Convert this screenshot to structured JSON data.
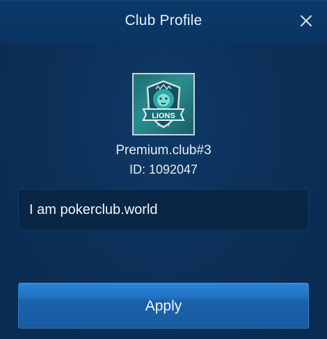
{
  "dialog": {
    "title": "Club Profile",
    "close_icon": "close-icon"
  },
  "club": {
    "logo_icon": "lions-club-logo",
    "logo_text": "LIONS",
    "name": "Premium.club#3",
    "id_text": "ID: 1092047",
    "description": "I am pokerclub.world"
  },
  "actions": {
    "apply_label": "Apply"
  },
  "colors": {
    "background": "#0c3059",
    "header": "#0a3462",
    "button": "#1f6fbf",
    "text": "#e8f1fb"
  }
}
